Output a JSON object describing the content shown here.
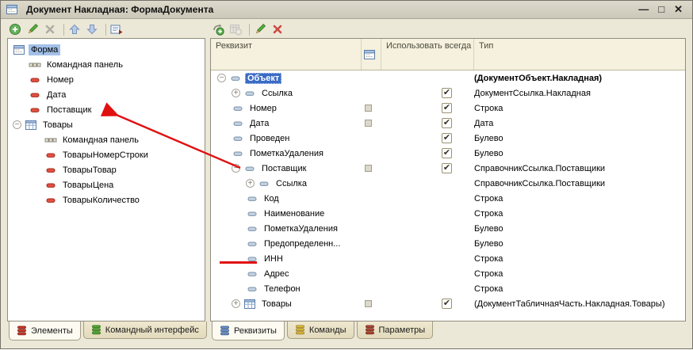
{
  "window": {
    "title": "Документ Накладная: ФормаДокумента",
    "controls": [
      {
        "name": "minimize-button",
        "glyph": "—"
      },
      {
        "name": "maximize-button",
        "glyph": "□"
      },
      {
        "name": "close-button",
        "glyph": "✕"
      }
    ]
  },
  "left_panel": {
    "toolbar": [
      {
        "name": "add-button",
        "icon": "add"
      },
      {
        "name": "edit-button",
        "icon": "edit"
      },
      {
        "name": "delete-button",
        "icon": "delete",
        "disabled": true
      },
      {
        "sep": true
      },
      {
        "name": "move-up-button",
        "icon": "move-up"
      },
      {
        "name": "move-down-button",
        "icon": "move-down"
      },
      {
        "sep": true
      },
      {
        "name": "check-form-button",
        "icon": "check-form"
      }
    ],
    "tree": [
      {
        "label": "Форма",
        "icon": "form",
        "level": 0,
        "expander": null,
        "selected": true
      },
      {
        "label": "Командная панель",
        "icon": "toolbar",
        "level": 1
      },
      {
        "label": "Номер",
        "icon": "field",
        "level": 1
      },
      {
        "label": "Дата",
        "icon": "field",
        "level": 1
      },
      {
        "label": "Поставщик",
        "icon": "field",
        "level": 1
      },
      {
        "label": "Товары",
        "icon": "table",
        "level": 0,
        "expander": "minus"
      },
      {
        "label": "Командная панель",
        "icon": "toolbar",
        "level": 2
      },
      {
        "label": "ТоварыНомерСтроки",
        "icon": "field",
        "level": 2
      },
      {
        "label": "ТоварыТовар",
        "icon": "field",
        "level": 2
      },
      {
        "label": "ТоварыЦена",
        "icon": "field",
        "level": 2
      },
      {
        "label": "ТоварыКоличество",
        "icon": "field",
        "level": 2
      }
    ],
    "tabs": [
      {
        "label": "Элементы",
        "active": true,
        "icon_fill": "#cf3a2e",
        "icon_stroke": "#7c1d12"
      },
      {
        "label": "Командный интерфейс",
        "active": false,
        "icon_fill": "#56ad34",
        "icon_stroke": "#2c6b16"
      }
    ]
  },
  "right_panel": {
    "toolbar": [
      {
        "name": "add-attribute-button",
        "icon": "add-attribute"
      },
      {
        "name": "add-tabular-section-button",
        "icon": "add-tabular",
        "disabled": true
      },
      {
        "sep": true
      },
      {
        "name": "edit-button",
        "icon": "edit"
      },
      {
        "name": "delete-button",
        "icon": "delete"
      }
    ],
    "table": {
      "headers": [
        "Реквизит",
        "",
        "Использовать всегда",
        "Тип"
      ],
      "rows": [
        {
          "label": "Объект",
          "icon": "attribute",
          "level": 0,
          "expander": "minus",
          "selected": true,
          "bold": true,
          "marker": false,
          "checked": null,
          "type": "(ДокументОбъект.Накладная)",
          "type_bold": true
        },
        {
          "label": "Ссылка",
          "icon": "attribute",
          "level": 1,
          "expander": "plus",
          "checked": true,
          "type": "ДокументСсылка.Накладная"
        },
        {
          "label": "Номер",
          "icon": "attribute",
          "level": 1,
          "marker": true,
          "checked": true,
          "type": "Строка"
        },
        {
          "label": "Дата",
          "icon": "attribute",
          "level": 1,
          "marker": true,
          "checked": true,
          "type": "Дата"
        },
        {
          "label": "Проведен",
          "icon": "attribute",
          "level": 1,
          "checked": true,
          "type": "Булево"
        },
        {
          "label": "ПометкаУдаления",
          "icon": "attribute",
          "level": 1,
          "checked": true,
          "type": "Булево"
        },
        {
          "label": "Поставщик",
          "icon": "attribute",
          "level": 1,
          "expander": "minus",
          "marker": true,
          "checked": true,
          "type": "СправочникСсылка.Поставщики"
        },
        {
          "label": "Ссылка",
          "icon": "attribute",
          "level": 2,
          "expander": "plus",
          "checked": null,
          "type": "СправочникСсылка.Поставщики"
        },
        {
          "label": "Код",
          "icon": "attribute",
          "level": 2,
          "checked": null,
          "type": "Строка"
        },
        {
          "label": "Наименование",
          "icon": "attribute",
          "level": 2,
          "checked": null,
          "type": "Строка"
        },
        {
          "label": "ПометкаУдаления",
          "icon": "attribute",
          "level": 2,
          "checked": null,
          "type": "Булево"
        },
        {
          "label": "Предопределенн...",
          "icon": "attribute",
          "level": 2,
          "checked": null,
          "type": "Булево"
        },
        {
          "label": "ИНН",
          "icon": "attribute",
          "level": 2,
          "checked": null,
          "type": "Строка",
          "underlined": true
        },
        {
          "label": "Адрес",
          "icon": "attribute",
          "level": 2,
          "checked": null,
          "type": "Строка"
        },
        {
          "label": "Телефон",
          "icon": "attribute",
          "level": 2,
          "checked": null,
          "type": "Строка"
        },
        {
          "label": "Товары",
          "icon": "table",
          "level": 1,
          "expander": "plus",
          "marker": true,
          "checked": true,
          "type": "(ДокументТабличнаяЧасть.Накладная.Товары)"
        }
      ]
    },
    "tabs": [
      {
        "label": "Реквизиты",
        "active": true,
        "icon_fill": "#6e93cf",
        "icon_stroke": "#33567e"
      },
      {
        "label": "Команды",
        "active": false,
        "icon_fill": "#e3c23e",
        "icon_stroke": "#8f741c"
      },
      {
        "label": "Параметры",
        "active": false,
        "icon_fill": "#b34a36",
        "icon_stroke": "#6b2517"
      }
    ]
  },
  "annotations": {
    "color": "#e01010",
    "arrow_points_to": "Поставщик",
    "underlined_item": "ИНН"
  }
}
